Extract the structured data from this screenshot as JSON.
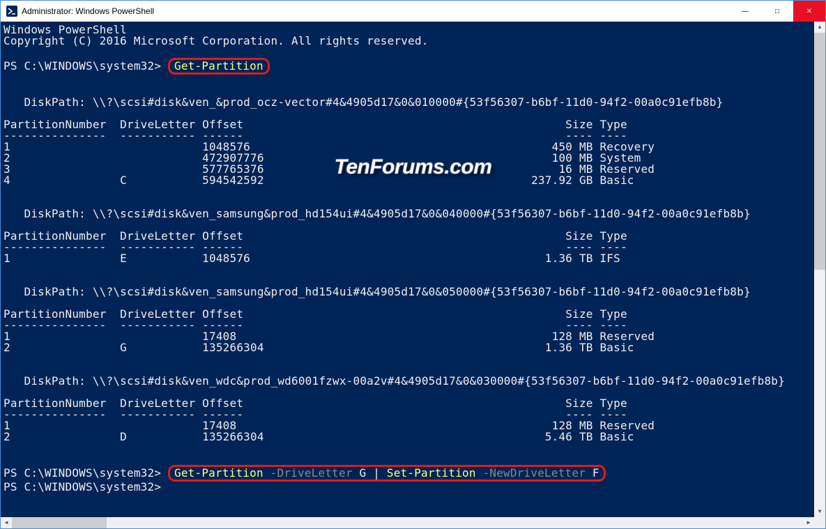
{
  "window": {
    "title": "Administrator: Windows PowerShell"
  },
  "banner": {
    "line1": "Windows PowerShell",
    "line2": "Copyright (C) 2016 Microsoft Corporation. All rights reserved."
  },
  "prompt": "PS C:\\WINDOWS\\system32>",
  "commands": {
    "first": "Get-Partition",
    "second_parts": {
      "a": "Get-Partition",
      "b": "-DriveLetter",
      "c": "G",
      "d": "|",
      "e": "Set-Partition",
      "f": "-NewDriveLetter",
      "g": "F"
    }
  },
  "headers": {
    "col1": "PartitionNumber",
    "col2": "DriveLetter",
    "col3": "Offset",
    "col4": "Size",
    "col5": "Type"
  },
  "header_dashes": {
    "col1": "---------------",
    "col2": "-----------",
    "col3": "------",
    "col4": "----",
    "col5": "----"
  },
  "disks": [
    {
      "path_label": "DiskPath:",
      "path": "\\\\?\\scsi#disk&ven_&prod_ocz-vector#4&4905d17&0&010000#{53f56307-b6bf-11d0-94f2-00a0c91efb8b}",
      "rows": [
        {
          "num": "1",
          "letter": "",
          "offset": "1048576",
          "size": "450 MB",
          "type": "Recovery"
        },
        {
          "num": "2",
          "letter": "",
          "offset": "472907776",
          "size": "100 MB",
          "type": "System"
        },
        {
          "num": "3",
          "letter": "",
          "offset": "577765376",
          "size": "16 MB",
          "type": "Reserved"
        },
        {
          "num": "4",
          "letter": "C",
          "offset": "594542592",
          "size": "237.92 GB",
          "type": "Basic"
        }
      ]
    },
    {
      "path_label": "DiskPath:",
      "path": "\\\\?\\scsi#disk&ven_samsung&prod_hd154ui#4&4905d17&0&040000#{53f56307-b6bf-11d0-94f2-00a0c91efb8b}",
      "rows": [
        {
          "num": "1",
          "letter": "E",
          "offset": "1048576",
          "size": "1.36 TB",
          "type": "IFS"
        }
      ]
    },
    {
      "path_label": "DiskPath:",
      "path": "\\\\?\\scsi#disk&ven_samsung&prod_hd154ui#4&4905d17&0&050000#{53f56307-b6bf-11d0-94f2-00a0c91efb8b}",
      "rows": [
        {
          "num": "1",
          "letter": "",
          "offset": "17408",
          "size": "128 MB",
          "type": "Reserved"
        },
        {
          "num": "2",
          "letter": "G",
          "offset": "135266304",
          "size": "1.36 TB",
          "type": "Basic"
        }
      ]
    },
    {
      "path_label": "DiskPath:",
      "path": "\\\\?\\scsi#disk&ven_wdc&prod_wd6001fzwx-00a2v#4&4905d17&0&030000#{53f56307-b6bf-11d0-94f2-00a0c91efb8b}",
      "rows": [
        {
          "num": "1",
          "letter": "",
          "offset": "17408",
          "size": "128 MB",
          "type": "Reserved"
        },
        {
          "num": "2",
          "letter": "D",
          "offset": "135266304",
          "size": "5.46 TB",
          "type": "Basic"
        }
      ]
    }
  ],
  "watermark": "TenForums.com"
}
